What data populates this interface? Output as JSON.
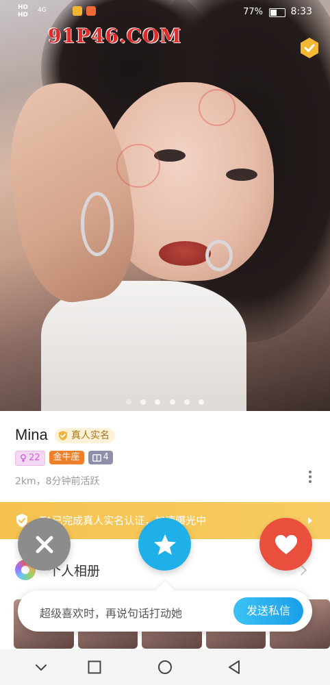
{
  "status_bar": {
    "sim1": "HD",
    "sim2": "HD",
    "network": "4G",
    "battery_text": "77%",
    "time": "8:33"
  },
  "watermark": "91P46.COM",
  "photo": {
    "page_count": 6,
    "active_index": 0
  },
  "profile": {
    "name": "Mina",
    "verified_label": "真人实名",
    "age": "22",
    "zodiac": "金牛座",
    "photo_count": "4",
    "activity": "2km，8分钟前活跃"
  },
  "banner": {
    "text": "TA已完成真人实名认证，加速曝光中"
  },
  "album": {
    "title": "个人相册"
  },
  "tip": {
    "text": "超级喜欢时，再说句话打动她",
    "send_label": "发送私信"
  },
  "colors": {
    "dislike": "#8c8c8c",
    "super_like": "#1fb0ea",
    "like": "#ea4e3d",
    "banner": "#f6c24e",
    "zodiac_tag": "#f07f2a"
  }
}
